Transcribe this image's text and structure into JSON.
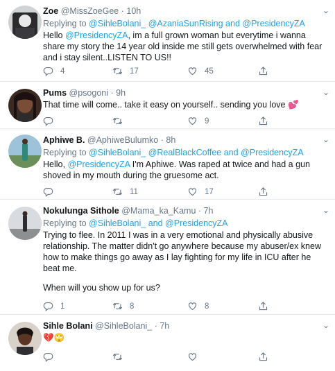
{
  "tweets": [
    {
      "name": "Zoe",
      "handle": "@MissZoeGee",
      "sep": "·",
      "time": "10h",
      "reply_prefix": "Replying to",
      "reply_mentions": "@SihleBolani_ @AzaniaSunRising and @PresidencyZA",
      "text_pre": "Hello ",
      "text_mention": "@PresidencyZA",
      "text_post": ", im a full grown woman but everytime i wanna share my story the 14 year old inside me still gets overwhelmed with fear and i stay silent..LISTEN TO US!!",
      "replies": "4",
      "retweets": "17",
      "likes": "45"
    },
    {
      "name": "Pums",
      "handle": "@psogoni",
      "sep": "·",
      "time": "9h",
      "text": "That time will come.. take it easy on yourself.. sending you love 💕",
      "replies": "",
      "retweets": "",
      "likes": "9"
    },
    {
      "name": "Aphiwe B.",
      "handle": "@AphiweBulumko",
      "sep": "·",
      "time": "8h",
      "reply_prefix": "Replying to",
      "reply_mentions": "@SihleBolani_ @RealBlackCoffee and @PresidencyZA",
      "text_pre": "Hello, ",
      "text_mention": "@PresidencyZA",
      "text_post": " I'm Aphiwe. Was raped at twice and had a gun shoved in my mouth during the gruesome act.",
      "replies": "",
      "retweets": "11",
      "likes": "17"
    },
    {
      "name": "Nokulunga Sithole",
      "handle": "@Mama_ka_Kamu",
      "sep": "·",
      "time": "7h",
      "reply_prefix": "Replying to",
      "reply_mentions": "@SihleBolani_ and @PresidencyZA",
      "text": "Trying to flee. In 2011 I was in a very emotional and physically  abusive relationship. The matter didn't go anywhere because my abuser/ex knew how to make things go away as I lay fighting for my life in ICU after he beat me.",
      "text2": "When will you show up for us?",
      "replies": "1",
      "retweets": "8",
      "likes": "8"
    },
    {
      "name": "Sihle Bolani",
      "handle": "@SihleBolani_",
      "sep": "·",
      "time": "7h",
      "text": "💔🙄",
      "replies": "",
      "retweets": "",
      "likes": ""
    }
  ],
  "colors": {
    "link": "#1da1f2",
    "muted": "#657786",
    "divider": "#e6ecf0"
  }
}
